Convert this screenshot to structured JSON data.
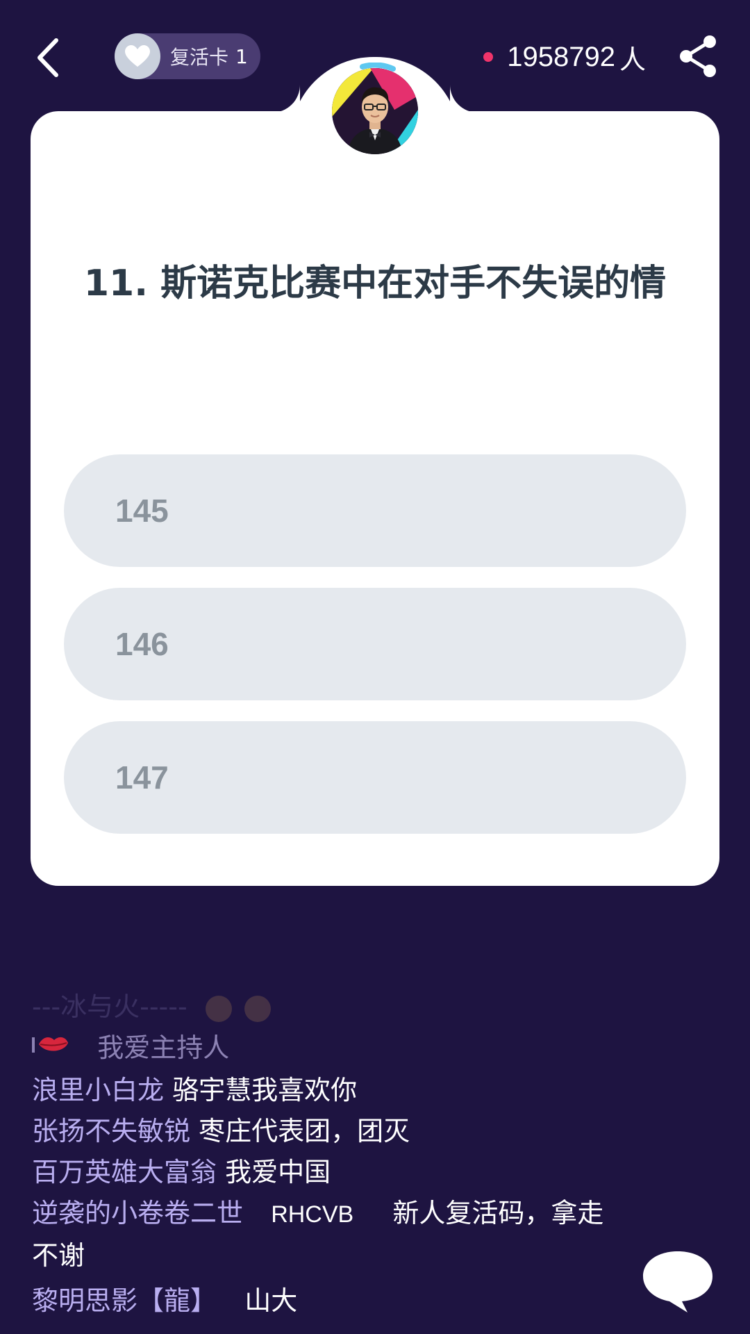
{
  "header": {
    "back_icon": "chevron-left-icon",
    "revive_card": {
      "icon": "heart-icon",
      "label": "复活卡",
      "count": "1"
    },
    "online": {
      "count": "1958792",
      "unit": "人",
      "dot_color": "#f0346a"
    },
    "share_icon": "share-icon"
  },
  "question": {
    "text": "11. 斯诺克比赛中在对手不失误的情",
    "options": [
      {
        "label": "145"
      },
      {
        "label": "146"
      },
      {
        "label": "147"
      }
    ]
  },
  "chat": {
    "messages": [
      {
        "name": "---冰与火-----",
        "text": ""
      },
      {
        "name": "",
        "text": "我爱主持人"
      },
      {
        "name": "浪里小白龙",
        "text": "骆宇慧我喜欢你"
      },
      {
        "name": "张扬不失敏锐",
        "text": "枣庄代表团，团灭"
      },
      {
        "name": "百万英雄大富翁",
        "text": "我爱中国"
      },
      {
        "name": "逆袭的小卷卷二世",
        "text_code": "RHCVB",
        "text": "新人复活码，拿走不谢"
      },
      {
        "name": "黎明思影【龍】",
        "text": "山大"
      }
    ]
  },
  "colors": {
    "background": "#1e1441",
    "card": "#ffffff",
    "option_bg": "#e5e9ee",
    "chat_name": "#b9aef0"
  }
}
